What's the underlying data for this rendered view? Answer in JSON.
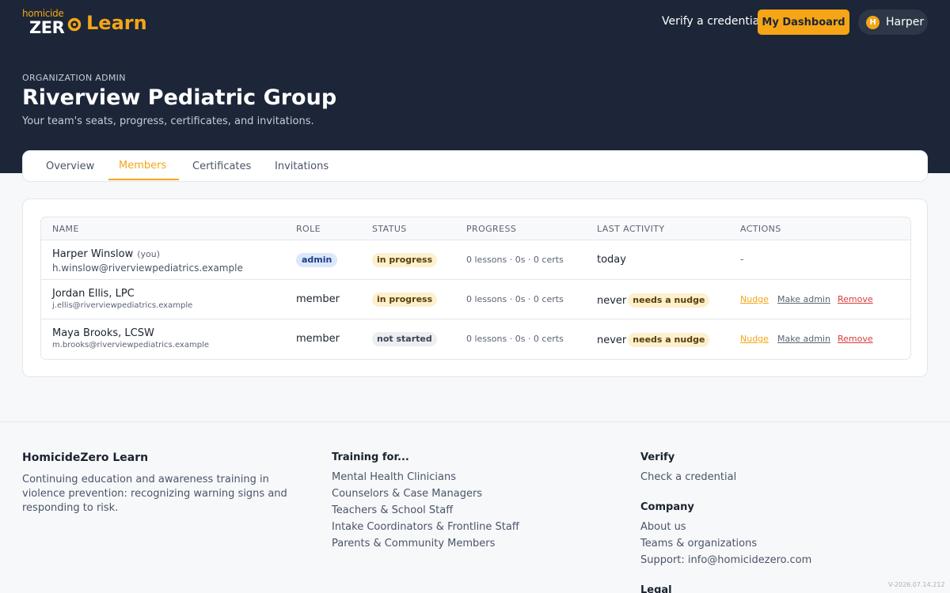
{
  "brand": {
    "logo_top": "homicide",
    "logo_zero": "ZER",
    "logo_learn": "Learn"
  },
  "nav": {
    "verify": "Verify a credential",
    "dashboard": "My Dashboard",
    "user_initial": "H",
    "user_name": "Harper"
  },
  "header": {
    "eyebrow": "ORGANIZATION ADMIN",
    "title": "Riverview Pediatric Group",
    "subtitle": "Your team's seats, progress, certificates, and invitations."
  },
  "tabs": [
    {
      "label": "Overview"
    },
    {
      "label": "Members",
      "active": true
    },
    {
      "label": "Certificates"
    },
    {
      "label": "Invitations"
    }
  ],
  "table": {
    "headers": {
      "name": "NAME",
      "role": "ROLE",
      "status": "STATUS",
      "progress": "PROGRESS",
      "activity": "LAST ACTIVITY",
      "actions": "ACTIONS"
    },
    "rows": [
      {
        "name": "Harper Winslow",
        "you": "(you)",
        "email": "h.winslow@riverviewpediatrics.example",
        "role": "admin",
        "status": "in progress",
        "progress": "0 lessons · 0s · 0 certs",
        "activity": "today",
        "actions_placeholder": "-"
      },
      {
        "name": "Jordan Ellis, LPC",
        "email": "j.ellis@riverviewpediatrics.example",
        "role": "member",
        "status": "in progress",
        "progress": "0 lessons · 0s · 0 certs",
        "activity": "never",
        "activity_badge": "needs a nudge",
        "action_nudge": "Nudge",
        "action_admin": "Make admin",
        "action_remove": "Remove"
      },
      {
        "name": "Maya Brooks, LCSW",
        "email": "m.brooks@riverviewpediatrics.example",
        "role": "member",
        "status": "not started",
        "progress": "0 lessons · 0s · 0 certs",
        "activity": "never",
        "activity_badge": "needs a nudge",
        "action_nudge": "Nudge",
        "action_admin": "Make admin",
        "action_remove": "Remove"
      }
    ]
  },
  "footer": {
    "brand": "HomicideZero Learn",
    "description": "Continuing education and awareness training in violence prevention: recognizing warning signs and responding to risk.",
    "training_heading": "Training for...",
    "training_links": [
      "Mental Health Clinicians",
      "Counselors & Case Managers",
      "Teachers & School Staff",
      "Intake Coordinators & Frontline Staff",
      "Parents & Community Members"
    ],
    "verify_heading": "Verify",
    "verify_link": "Check a credential",
    "company_heading": "Company",
    "company_links": [
      "About us",
      "Teams & organizations",
      "Support: info@homicidezero.com"
    ],
    "legal_heading": "Legal",
    "version": "V-2026.07.14.212"
  },
  "colors": {
    "navy": "#1c2638",
    "accent": "#f5a516",
    "danger": "#d93b3b"
  }
}
